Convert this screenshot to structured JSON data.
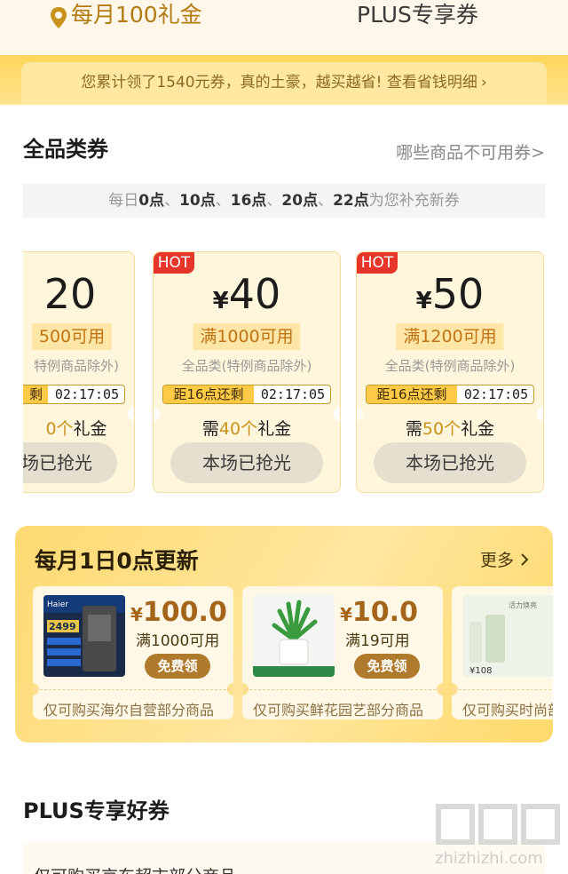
{
  "tabs": {
    "left": "每月100礼金",
    "right": "PLUS专享券"
  },
  "banner": {
    "text": "您累计领了1540元券，真的土豪，越买越省! 查看省钱明细",
    "chevron": "›"
  },
  "section": {
    "title": "全品类券",
    "link": "哪些商品不可用券>"
  },
  "refill": {
    "prefix": "每日",
    "times": [
      "0点",
      "10点",
      "16点",
      "20点",
      "22点"
    ],
    "sep": "、",
    "suffix": "为您补充新券"
  },
  "coupons": [
    {
      "hot": "",
      "yen": "",
      "amount": "20",
      "threshold": "500可用",
      "scope": "特例商品除外)",
      "timer_label": "剩",
      "timer": "02:17:05",
      "need_prefix": "",
      "need_num": "0个",
      "need_suffix": "礼金",
      "button": "场已抢光"
    },
    {
      "hot": "HOT",
      "yen": "¥",
      "amount": "40",
      "threshold": "满1000可用",
      "scope": "全品类(特例商品除外)",
      "timer_label": "距16点还剩",
      "timer": "02:17:05",
      "need_prefix": "需",
      "need_num": "40个",
      "need_suffix": "礼金",
      "button": "本场已抢光"
    },
    {
      "hot": "HOT",
      "yen": "¥",
      "amount": "50",
      "threshold": "满1200可用",
      "scope": "全品类(特例商品除外)",
      "timer_label": "距16点还剩",
      "timer": "02:17:05",
      "need_prefix": "需",
      "need_num": "50个",
      "need_suffix": "礼金",
      "button": "本场已抢光"
    }
  ],
  "monthly": {
    "title": "每月1日0点更新",
    "more": "更多",
    "gifts": [
      {
        "yen": "¥",
        "amount": "100.0",
        "condition": "满1000可用",
        "button": "免费领",
        "footer": "仅可购买海尔自营部分商品",
        "image_text": [
          "Haier",
          "2499"
        ]
      },
      {
        "yen": "¥",
        "amount": "10.0",
        "condition": "满19可用",
        "button": "免费领",
        "footer": "仅可购买鲜花园艺部分商品",
        "image_text": []
      },
      {
        "yen": "",
        "amount": "",
        "condition": "",
        "button": "",
        "footer": "仅可购买时尚部",
        "image_text": [
          "活力焕亮",
          "¥108"
        ]
      }
    ]
  },
  "plus": {
    "title": "PLUS专享好券",
    "card_text": "仅可购买京东超市部分商品"
  },
  "watermark": {
    "text": "zhizhizhi.com"
  },
  "colors": {
    "accent": "#ffcb46",
    "hot": "#e8352a",
    "gold_text": "#c17314",
    "button_gold": "#b07a2c"
  }
}
